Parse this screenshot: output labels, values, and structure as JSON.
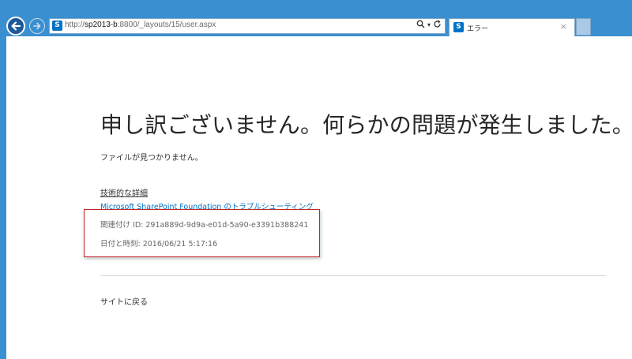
{
  "browser": {
    "url_prefix": "http://",
    "url_host": "sp2013-b",
    "url_path": ":8800/_layouts/15/user.aspx",
    "search_icon": "search-icon",
    "refresh_icon": "refresh-icon",
    "tab_title": "エラー",
    "tab_close": "×",
    "favicon_text": "S"
  },
  "page": {
    "title": "申し訳ございません。何らかの問題が発生しました。",
    "message": "ファイルが見つかりません。",
    "technical_details": "技術的な詳細",
    "troubleshoot_link": "Microsoft SharePoint Foundation のトラブルシューティング",
    "correlation_id": "関連付け ID: 291a889d-9d9a-e01d-5a90-e3391b388241",
    "date_time": "日付と時刻: 2016/06/21 5:17:16",
    "back_to_site": "サイトに戻る"
  },
  "colors": {
    "chrome": "#3a8fd0",
    "link": "#0072c6",
    "highlight": "#c0282d"
  }
}
